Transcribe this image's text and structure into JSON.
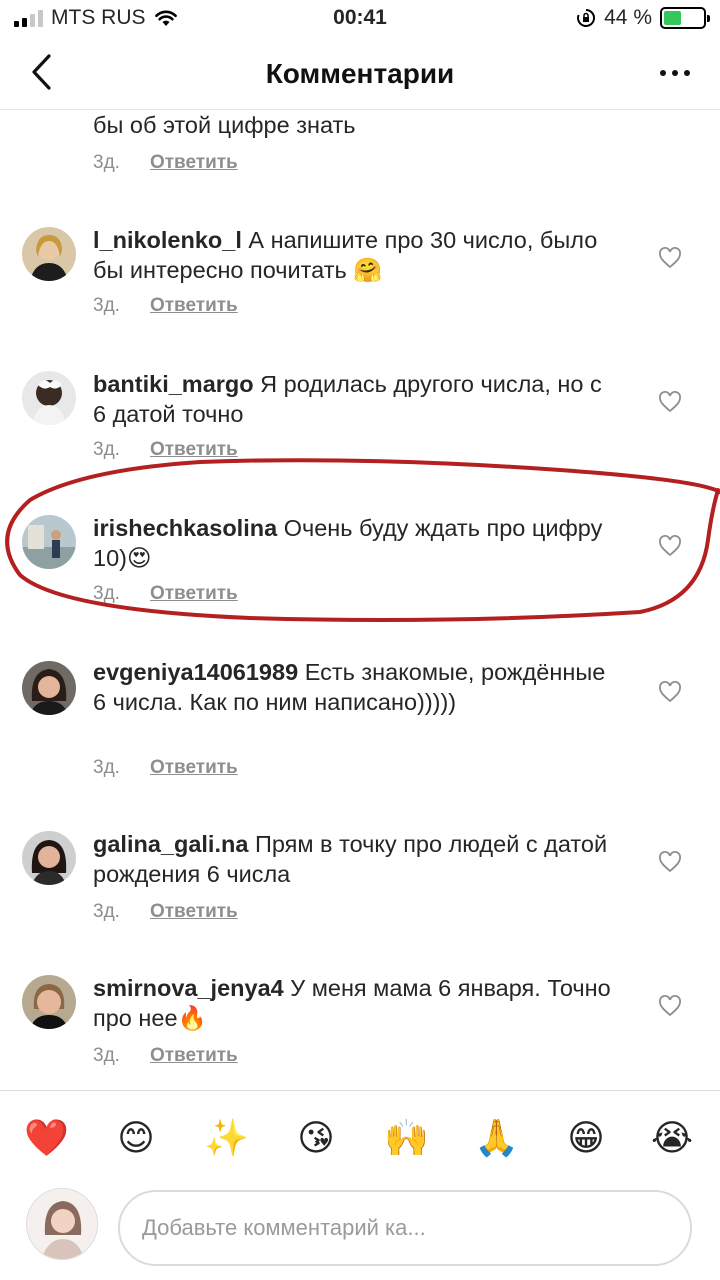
{
  "status_bar": {
    "carrier": "MTS RUS",
    "time": "00:41",
    "battery": "44 %",
    "battery_level": 0.44
  },
  "header": {
    "title": "Комментарии"
  },
  "comments": [
    {
      "username": "",
      "text": "бы об этой цифре знать",
      "time": "3д.",
      "reply": "Ответить"
    },
    {
      "username": "l_nikolenko_l",
      "text": "А напишите про 30 число, было бы интересно почитать 🤗",
      "time": "3д.",
      "reply": "Ответить"
    },
    {
      "username": "bantiki_margo",
      "text": "Я родилась другого числа, но с 6 датой точно",
      "time": "3д.",
      "reply": "Ответить"
    },
    {
      "username": "irishechkasolina",
      "text": "Очень буду ждать про цифру 10)😍",
      "time": "3д.",
      "reply": "Ответить"
    },
    {
      "username": "evgeniya14061989",
      "text": "Есть знакомые, рождённые 6 числа. Как по ним написано)))))",
      "time": "3д.",
      "reply": "Ответить"
    },
    {
      "username": "galina_gali.na",
      "text": "Прям в точку про людей с датой рождения 6 числа",
      "time": "3д.",
      "reply": "Ответить"
    },
    {
      "username": "smirnova_jenya4",
      "text": "У меня мама 6 января. Точно про нее🔥",
      "time": "3д.",
      "reply": "Ответить"
    }
  ],
  "emoji_bar": [
    "❤️",
    "😊",
    "✨",
    "😘",
    "🙌",
    "🙏",
    "😁",
    "😭"
  ],
  "composer": {
    "placeholder": "Добавьте комментарий ка..."
  },
  "colors": {
    "annotation": "#b3201f",
    "meta_text": "#8e8e8e",
    "battery_fill": "#34c759"
  }
}
